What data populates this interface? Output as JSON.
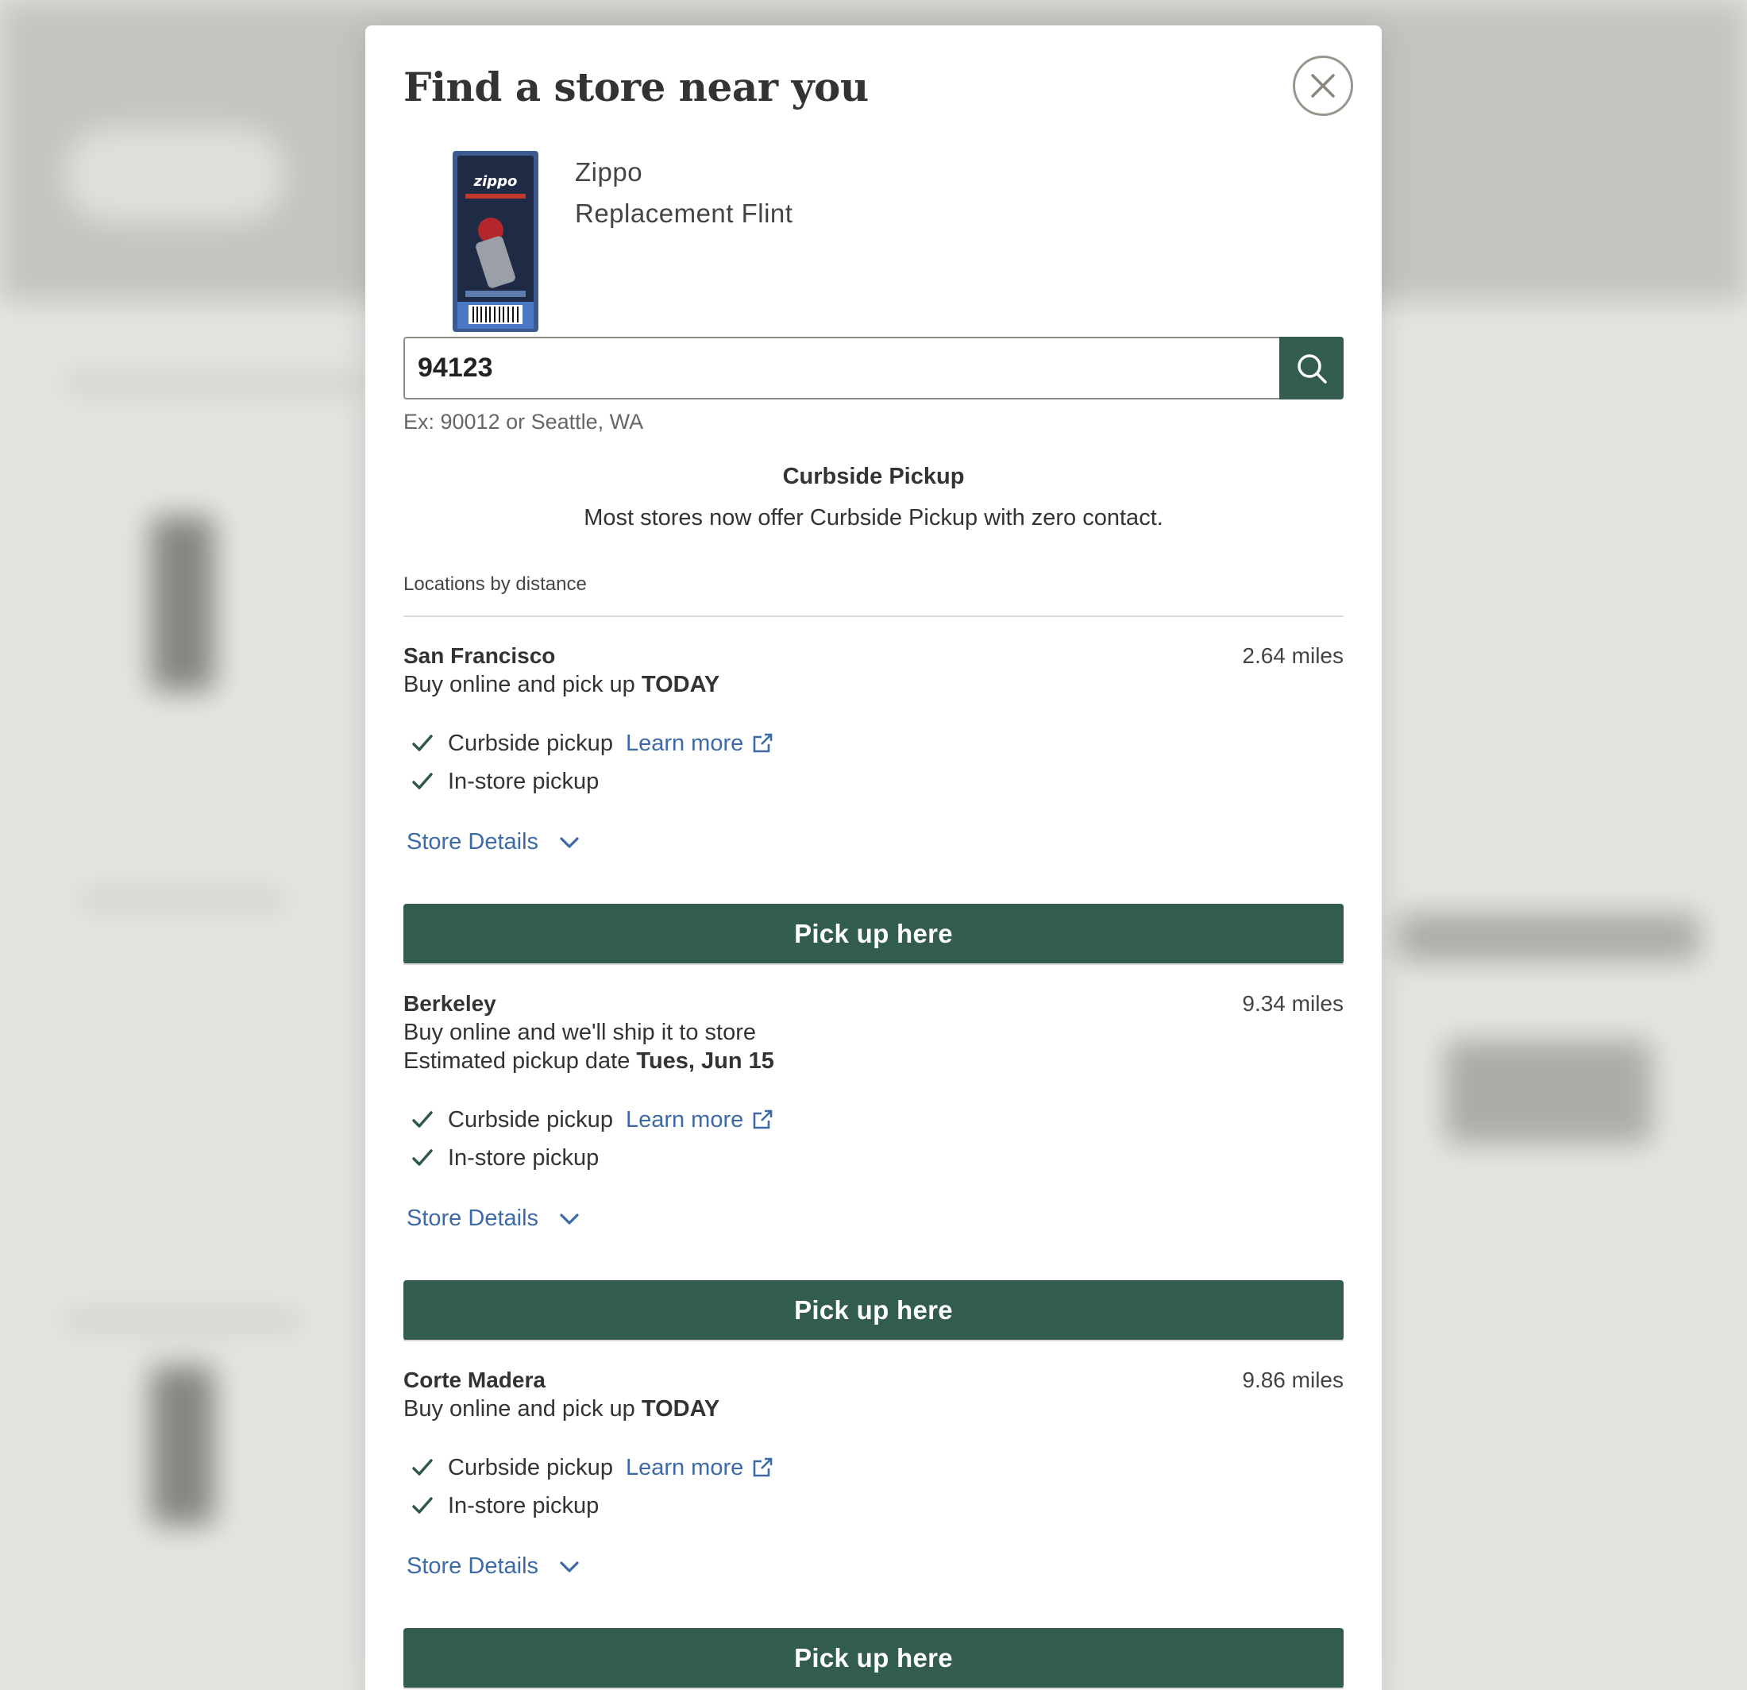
{
  "modal": {
    "title": "Find a store near you"
  },
  "product": {
    "brand": "Zippo",
    "name": "Replacement Flint",
    "image_icon": "zippo-flint-package"
  },
  "search": {
    "value": "94123",
    "hint": "Ex: 90012 or Seattle, WA"
  },
  "curbside": {
    "title": "Curbside Pickup",
    "text": "Most stores now offer Curbside Pickup with zero contact."
  },
  "locations_label": "Locations by distance",
  "stores": [
    {
      "name": "San Francisco",
      "distance": "2.64 miles",
      "line1_prefix": "Buy online and pick up ",
      "line1_bold": "TODAY",
      "curbside_label": "Curbside pickup",
      "learn_more": "Learn more",
      "instore_label": "In-store pickup",
      "details_label": "Store Details",
      "button_label": "Pick up here"
    },
    {
      "name": "Berkeley",
      "distance": "9.34 miles",
      "line1": "Buy online and we'll ship it to store",
      "line2_prefix": "Estimated pickup date ",
      "line2_bold": "Tues, Jun 15",
      "curbside_label": "Curbside pickup",
      "learn_more": "Learn more",
      "instore_label": "In-store pickup",
      "details_label": "Store Details",
      "button_label": "Pick up here"
    },
    {
      "name": "Corte Madera",
      "distance": "9.86 miles",
      "line1_prefix": "Buy online and pick up ",
      "line1_bold": "TODAY",
      "curbside_label": "Curbside pickup",
      "learn_more": "Learn more",
      "instore_label": "In-store pickup",
      "details_label": "Store Details",
      "button_label": "Pick up here"
    }
  ],
  "colors": {
    "primary": "#335c50",
    "link": "#3d6aa6",
    "check": "#2f5a49"
  }
}
